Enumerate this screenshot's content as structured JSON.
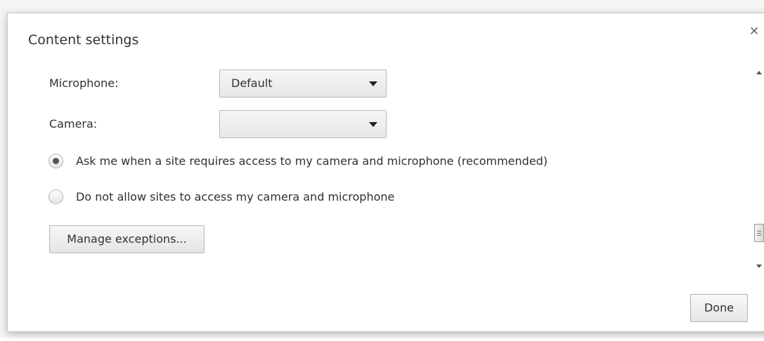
{
  "dialog": {
    "title": "Content settings",
    "close_icon": "close-icon",
    "close_glyph": "✕"
  },
  "microphone": {
    "label": "Microphone:",
    "selected": "Default"
  },
  "camera": {
    "label": "Camera:",
    "selected": ""
  },
  "options": [
    {
      "label": "Ask me when a site requires access to my camera and microphone (recommended)",
      "checked": true
    },
    {
      "label": "Do not allow sites to access my camera and microphone",
      "checked": false
    }
  ],
  "manage_exceptions_label": "Manage exceptions...",
  "done_label": "Done"
}
